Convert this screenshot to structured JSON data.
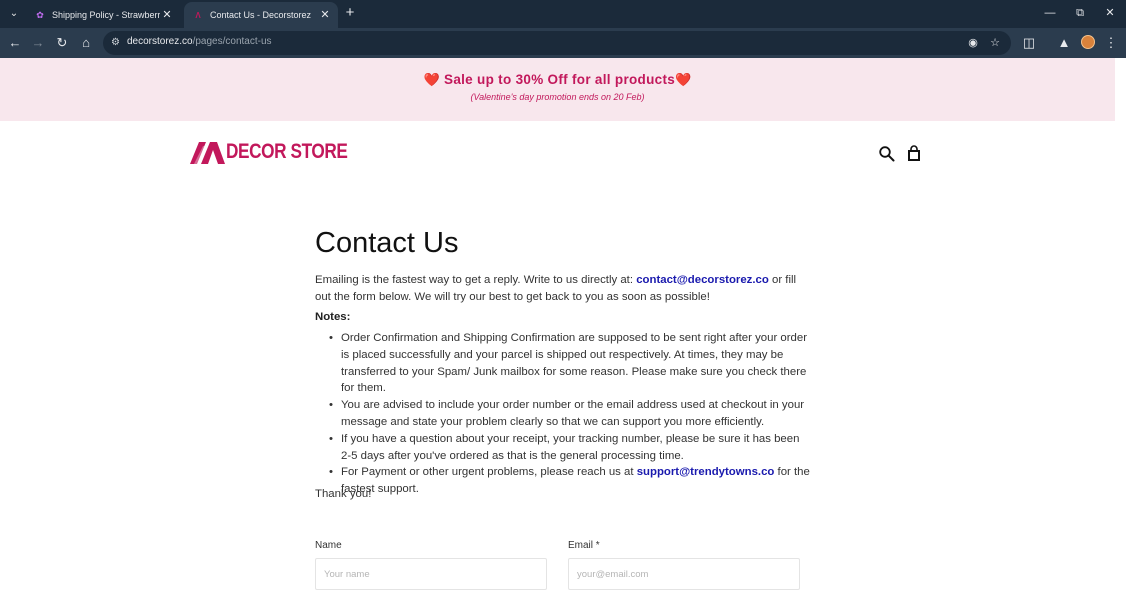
{
  "browser": {
    "tabs": [
      {
        "title": "Shipping Policy - Strawberrycity",
        "active": false
      },
      {
        "title": "Contact Us - Decorstorez",
        "active": true
      }
    ],
    "url_domain": "decorstorez.co",
    "url_path": "/pages/contact-us"
  },
  "promo": {
    "main": "Sale up to 30% Off for all products",
    "sub": "(Valentine's day promotion ends on 20 Feb)"
  },
  "header": {
    "logo_text": "DECOR STORE"
  },
  "page": {
    "title": "Contact Us",
    "intro_before": "Emailing is the fastest way to get a reply. Write to us directly at: ",
    "intro_email": "contact@decorstorez.co",
    "intro_after": " or fill out the form below. We will try our best to get back to you as soon as possible!",
    "notes_heading": "Notes:",
    "notes": [
      "Order Confirmation and Shipping Confirmation are supposed to be sent right after your order is placed successfully and your parcel is shipped out respectively. At times, they may be transferred to your Spam/ Junk mailbox for some reason. Please make sure you check there for them.",
      "You are advised to include your order number or the email address used at checkout in your message and state your problem clearly so that we can support you more efficiently.",
      "If you have a question about your receipt, your tracking number, please be sure it has been 2-5 days after you've ordered as that is the general processing time."
    ],
    "note4_before": "For Payment or other urgent problems, please reach us at ",
    "note4_email": "support@trendytowns.co",
    "note4_after": " for the fastest support.",
    "thanks": "Thank you!"
  },
  "form": {
    "name_label": "Name",
    "name_placeholder": "Your name",
    "email_label": "Email *",
    "email_placeholder": "your@email.com"
  },
  "colors": {
    "brand": "#c2185b",
    "promo_bg": "#f8e7ed",
    "link": "#1a1aae",
    "chrome_dark": "#1b2a3a",
    "chrome_toolbar": "#2b3c4e"
  }
}
